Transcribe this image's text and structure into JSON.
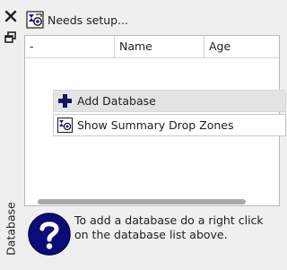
{
  "sidebar": {
    "close_icon": "close-icon",
    "float_icon": "float-window-icon",
    "tab_label": "Database"
  },
  "setup": {
    "icon": "setup-wizard-icon",
    "label": "Needs setup..."
  },
  "list": {
    "columns": [
      "-",
      "Name",
      "Age"
    ],
    "actions": [
      {
        "icon": "plus-icon",
        "label": "Add Database"
      },
      {
        "icon": "drop-zones-icon",
        "label": "Show Summary Drop Zones"
      }
    ]
  },
  "hint": {
    "icon": "question-mark-icon",
    "text": "To add a database do a right click on the database list above."
  },
  "colors": {
    "accent": "#1a1a8c",
    "panel_bg": "#ffffff",
    "window_bg": "#efefef"
  }
}
